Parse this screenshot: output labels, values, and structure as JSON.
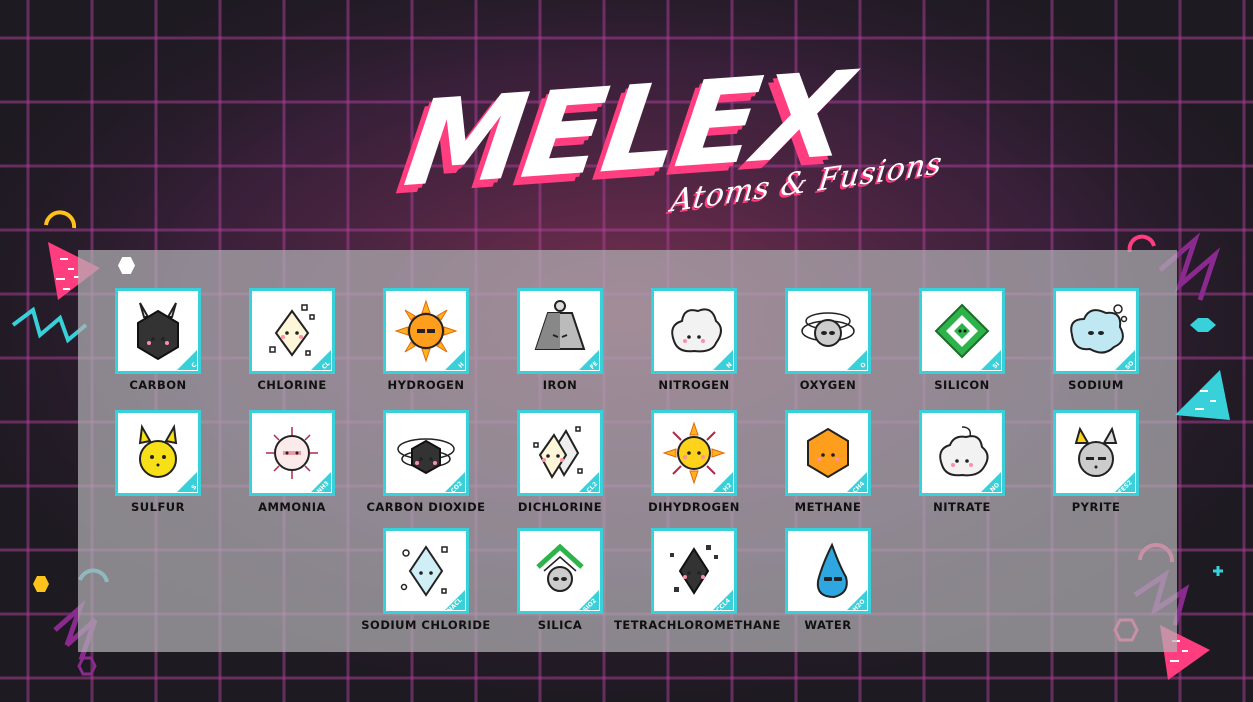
{
  "title": {
    "main": "MELEX",
    "subtitle": "Atoms & Fusions"
  },
  "colors": {
    "accent": "#ff3d7f",
    "card_border": "#39d1d9",
    "background": "#1d1a21"
  },
  "atoms": [
    {
      "name": "Carbon",
      "symbol": "C",
      "icon": "carbon-icon"
    },
    {
      "name": "Chlorine",
      "symbol": "CL",
      "icon": "chlorine-icon"
    },
    {
      "name": "Hydrogen",
      "symbol": "H",
      "icon": "hydrogen-icon"
    },
    {
      "name": "Iron",
      "symbol": "FE",
      "icon": "iron-icon"
    },
    {
      "name": "Nitrogen",
      "symbol": "N",
      "icon": "nitrogen-icon"
    },
    {
      "name": "Oxygen",
      "symbol": "O",
      "icon": "oxygen-icon"
    },
    {
      "name": "Silicon",
      "symbol": "SI",
      "icon": "silicon-icon"
    },
    {
      "name": "Sodium",
      "symbol": "SO",
      "icon": "sodium-icon"
    },
    {
      "name": "Sulfur",
      "symbol": "S",
      "icon": "sulfur-icon"
    },
    {
      "name": "Ammonia",
      "symbol": "NH3",
      "icon": "ammonia-icon"
    },
    {
      "name": "Carbon Dioxide",
      "symbol": "CO2",
      "icon": "carbon-dioxide-icon"
    },
    {
      "name": "Dichlorine",
      "symbol": "CL2",
      "icon": "dichlorine-icon"
    },
    {
      "name": "Dihydrogen",
      "symbol": "H2",
      "icon": "dihydrogen-icon"
    },
    {
      "name": "Methane",
      "symbol": "CH4",
      "icon": "methane-icon"
    },
    {
      "name": "Nitrate",
      "symbol": "NO",
      "icon": "nitrate-icon"
    },
    {
      "name": "Pyrite",
      "symbol": "FES2",
      "icon": "pyrite-icon"
    },
    {
      "name": "Sodium Chloride",
      "symbol": "NACL",
      "icon": "sodium-chloride-icon"
    },
    {
      "name": "Silica",
      "symbol": "SIO2",
      "icon": "silica-icon"
    },
    {
      "name": "Tetrachloromethane",
      "symbol": "CCL4",
      "icon": "tetrachloromethane-icon"
    },
    {
      "name": "Water",
      "symbol": "H2O",
      "icon": "water-icon"
    }
  ]
}
